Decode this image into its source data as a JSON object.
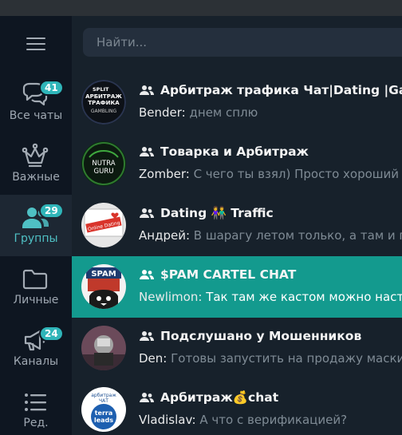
{
  "sidebar": {
    "menu_icon": "hamburger-menu-icon",
    "folders": [
      {
        "label": "Все чаты",
        "icon": "chat-bubbles-icon",
        "badge": "41",
        "active": false
      },
      {
        "label": "Важные",
        "icon": "crown-icon",
        "badge": "",
        "active": false
      },
      {
        "label": "Группы",
        "icon": "group-people-icon",
        "badge": "29",
        "active": true
      },
      {
        "label": "Личные",
        "icon": "folder-icon",
        "badge": "",
        "active": false
      },
      {
        "label": "Каналы",
        "icon": "megaphone-icon",
        "badge": "24",
        "active": false
      },
      {
        "label": "Ред.",
        "icon": "list-edit-icon",
        "badge": "",
        "active": false
      }
    ]
  },
  "search": {
    "placeholder": "Найти..."
  },
  "chats": [
    {
      "title": "Арбитраж трафика Чат|Dating |Gambling",
      "sender": "Bender:",
      "message": "днем сплю",
      "avatar_text": [
        "SPLIT",
        "АРБИТРАЖ",
        "ТРАФИКА",
        "GAMBLING"
      ],
      "active": false
    },
    {
      "title": "Товарка и Арбитраж",
      "sender": "Zomber:",
      "message": "С чего ты взял) Просто хороший оффер",
      "avatar_text": [
        "NUTRA",
        "GURU"
      ],
      "active": false
    },
    {
      "title": "Dating 👫 Traffic",
      "sender": "Андрей:",
      "message": "В шарагу летом только, а там и гараж",
      "avatar_text": [
        "Online Dating"
      ],
      "active": false
    },
    {
      "title": "$PAM CARTEL CHAT",
      "sender": "Newlimon:",
      "message": "Так там же кастом можно настроить",
      "avatar_text": [
        "SPAM"
      ],
      "active": true
    },
    {
      "title": "Подслушано у Мошенников",
      "sender": "Den:",
      "message": "Готовы запустить на продажу маски, если",
      "avatar_text": [],
      "active": false
    },
    {
      "title": "Арбитраж💰chat",
      "sender": "Vladislav:",
      "message": "А что с верификацией?",
      "avatar_text": [
        "арбитраж",
        "ЧАТ",
        "terra",
        "leads"
      ],
      "active": false
    }
  ],
  "colors": {
    "accent": "#2fb5b9",
    "active_row": "#139a8e",
    "sidebar_bg": "#0e1621",
    "list_bg": "#17212b"
  }
}
